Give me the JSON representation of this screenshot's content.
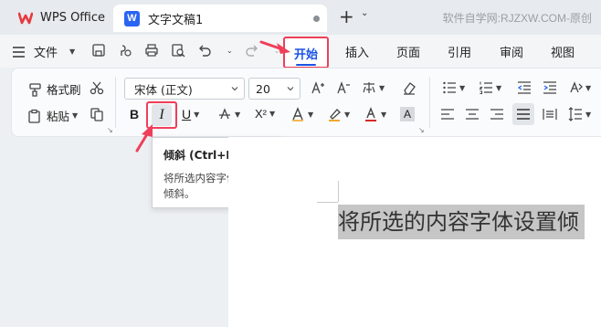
{
  "titlebar": {
    "app_tab_label": "WPS Office",
    "doc_tab_label": "文字文稿1",
    "doc_icon_letter": "W",
    "watermark": "软件自学网:RJZXW.COM-原创"
  },
  "menubar": {
    "file_label": "文件",
    "tabs": [
      "开始",
      "插入",
      "页面",
      "引用",
      "审阅",
      "视图"
    ]
  },
  "ribbon": {
    "format_painter_label": "格式刷",
    "paste_label": "粘贴",
    "font_name": "宋体 (正文)",
    "font_size": "20",
    "bold_label": "B",
    "italic_label": "I",
    "underline_label": "U",
    "superscript_label": "X²",
    "highlight_letter": "A"
  },
  "tooltip": {
    "title": "倾斜 (Ctrl+I)",
    "body": "将所选内容字体设置为倾斜。"
  },
  "document": {
    "text": "将所选的内容字体设置倾"
  },
  "colors": {
    "accent": "#1a52e4",
    "highlight_red": "#ef3f5a",
    "wps_logo": "#e8383d",
    "selection": "#c6c6c6"
  }
}
